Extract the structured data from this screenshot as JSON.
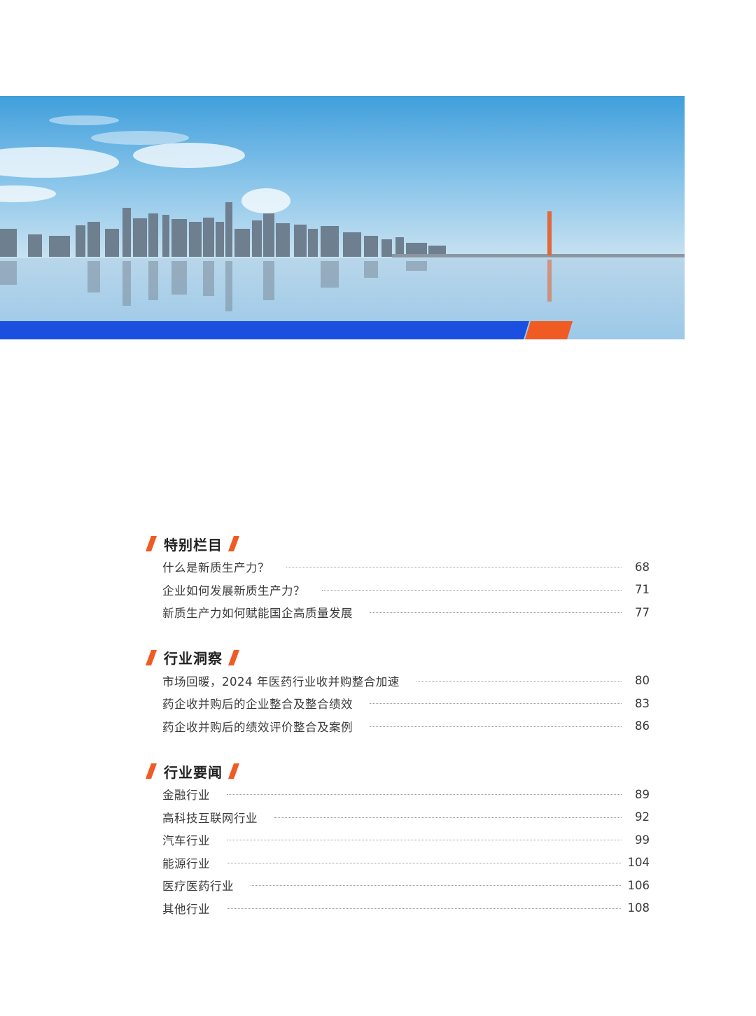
{
  "toc": {
    "sections": [
      {
        "title": "特别栏目",
        "entries": [
          {
            "title": "什么是新质生产力？",
            "page": "68"
          },
          {
            "title": "企业如何发展新质生产力？",
            "page": "71"
          },
          {
            "title": "新质生产力如何赋能国企高质量发展",
            "page": "77"
          }
        ]
      },
      {
        "title": "行业洞察",
        "entries": [
          {
            "title": "市场回暖，2024 年医药行业收并购整合加速",
            "page": "80"
          },
          {
            "title": "药企收并购后的企业整合及整合绩效",
            "page": "83"
          },
          {
            "title": "药企收并购后的绩效评价整合及案例",
            "page": "86"
          }
        ]
      },
      {
        "title": "行业要闻",
        "entries": [
          {
            "title": "金融行业",
            "page": "89"
          },
          {
            "title": "高科技互联网行业",
            "page": "92"
          },
          {
            "title": "汽车行业",
            "page": "99"
          },
          {
            "title": "能源行业",
            "page": "104"
          },
          {
            "title": "医疗医药行业",
            "page": "106"
          },
          {
            "title": "其他行业",
            "page": "108"
          }
        ]
      }
    ]
  },
  "colors": {
    "accent_orange": "#f05a23",
    "accent_blue": "#1a4fe0"
  }
}
